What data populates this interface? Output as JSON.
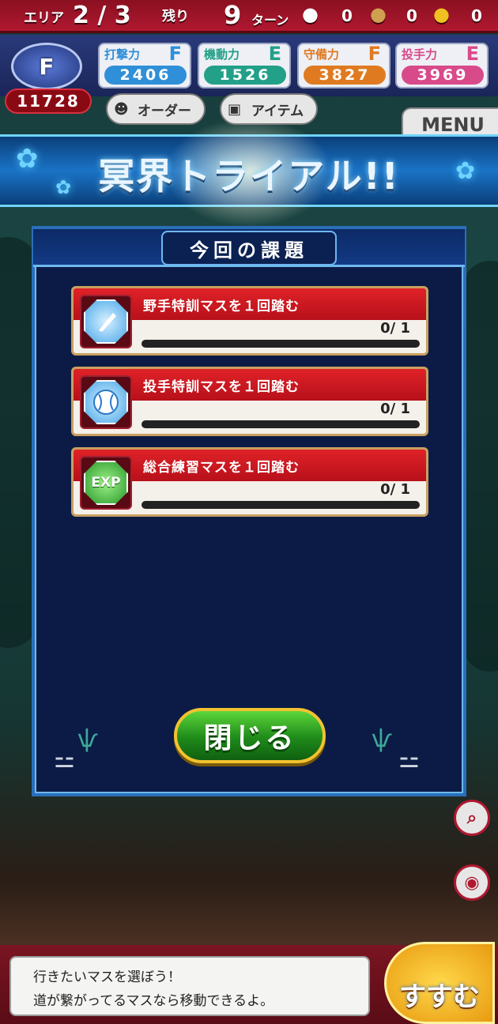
{
  "topbar": {
    "area_label": "エリア",
    "area_value": "2 / 3",
    "remaining_label": "残り",
    "turns_value": "9",
    "turns_label": "ターン",
    "bag1_count": "0",
    "bag2_count": "0",
    "bag3_count": "0"
  },
  "team": {
    "rank": "F",
    "score": "11728",
    "stats": [
      {
        "label": "打撃力",
        "grade": "F",
        "value": "2406",
        "color": "#2f8fd8"
      },
      {
        "label": "機動力",
        "grade": "E",
        "value": "1526",
        "color": "#22a088"
      },
      {
        "label": "守備力",
        "grade": "F",
        "value": "3827",
        "color": "#e07a20"
      },
      {
        "label": "投手力",
        "grade": "E",
        "value": "3969",
        "color": "#d84a8a"
      }
    ]
  },
  "buttons": {
    "order": "オーダー",
    "item": "アイテム",
    "menu": "MENU",
    "close": "閉じる",
    "go": "すすむ"
  },
  "banner": {
    "title": "冥界トライアル!!"
  },
  "panel": {
    "title": "今回の課題",
    "tasks": [
      {
        "label": "野手特訓マスを１回踏む",
        "progress": "0/ 1",
        "icon": "bat-icon"
      },
      {
        "label": "投手特訓マスを１回踏む",
        "progress": "0/ 1",
        "icon": "baseball-icon"
      },
      {
        "label": "総合練習マスを１回踏む",
        "progress": "0/ 1",
        "icon": "exp-icon",
        "icon_text": "EXP"
      }
    ]
  },
  "message": {
    "line1": "行きたいマスを選ぼう！",
    "line2": "道が繋がってるマスなら移動できるよ。"
  },
  "side": {
    "plus": "+",
    "minus": "−"
  }
}
